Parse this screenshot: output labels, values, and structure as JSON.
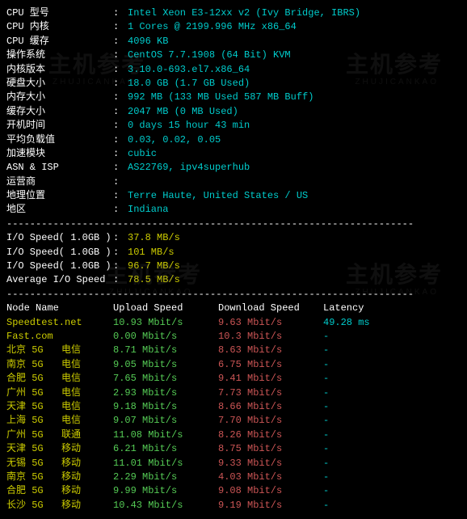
{
  "sys": {
    "rows": [
      {
        "label": "CPU 型号",
        "value": "Intel Xeon E3-12xx v2 (Ivy Bridge, IBRS)"
      },
      {
        "label": "CPU 内核",
        "value": "1 Cores @ 2199.996 MHz x86_64"
      },
      {
        "label": "CPU 缓存",
        "value": "4096 KB"
      },
      {
        "label": "操作系统",
        "value": "CentOS 7.7.1908 (64 Bit) KVM"
      },
      {
        "label": "内核版本",
        "value": "3.10.0-693.el7.x86_64"
      },
      {
        "label": "硬盘大小",
        "value": "18.0 GB (1.7 GB Used)"
      },
      {
        "label": "内存大小",
        "value": "992 MB (133 MB Used 587 MB Buff)"
      },
      {
        "label": "缓存大小",
        "value": "2047 MB (0 MB Used)"
      },
      {
        "label": "开机时间",
        "value": "0 days 15 hour 43 min"
      },
      {
        "label": "平均负载值",
        "value": "0.03, 0.02, 0.05"
      },
      {
        "label": "加速模块",
        "value": "cubic"
      },
      {
        "label": "ASN & ISP",
        "value": "AS22769, ipv4superhub"
      },
      {
        "label": "运营商",
        "value": ""
      },
      {
        "label": "地理位置",
        "value": "Terre Haute, United States / US"
      },
      {
        "label": "地区",
        "value": "Indiana"
      }
    ]
  },
  "io": {
    "rows": [
      {
        "label": "I/O Speed( 1.0GB )",
        "value": "37.8 MB/s"
      },
      {
        "label": "I/O Speed( 1.0GB )",
        "value": "101 MB/s"
      },
      {
        "label": "I/O Speed( 1.0GB )",
        "value": "96.7 MB/s"
      },
      {
        "label": "Average I/O Speed",
        "value": "78.5 MB/s"
      }
    ]
  },
  "speed": {
    "headers": {
      "node": "Node Name",
      "upload": "Upload Speed",
      "download": "Download Speed",
      "latency": "Latency"
    },
    "rows": [
      {
        "name": "Speedtest.net",
        "isp": "",
        "up": "10.93 Mbit/s",
        "down": "9.63 Mbit/s",
        "lat": "49.28 ms"
      },
      {
        "name": "Fast.com",
        "isp": "",
        "up": "0.00 Mbit/s",
        "down": "10.3 Mbit/s",
        "lat": "-"
      },
      {
        "name": "北京 5G",
        "isp": "电信",
        "up": "8.71 Mbit/s",
        "down": "8.63 Mbit/s",
        "lat": "-"
      },
      {
        "name": "南京 5G",
        "isp": "电信",
        "up": "9.05 Mbit/s",
        "down": "6.75 Mbit/s",
        "lat": "-"
      },
      {
        "name": "合肥 5G",
        "isp": "电信",
        "up": "7.65 Mbit/s",
        "down": "9.41 Mbit/s",
        "lat": "-"
      },
      {
        "name": "广州 5G",
        "isp": "电信",
        "up": "2.93 Mbit/s",
        "down": "7.73 Mbit/s",
        "lat": "-"
      },
      {
        "name": "天津 5G",
        "isp": "电信",
        "up": "9.18 Mbit/s",
        "down": "8.66 Mbit/s",
        "lat": "-"
      },
      {
        "name": "上海 5G",
        "isp": "电信",
        "up": "9.07 Mbit/s",
        "down": "7.70 Mbit/s",
        "lat": "-"
      },
      {
        "name": "广州 5G",
        "isp": "联通",
        "up": "11.08 Mbit/s",
        "down": "8.26 Mbit/s",
        "lat": "-"
      },
      {
        "name": "天津 5G",
        "isp": "移动",
        "up": "6.21 Mbit/s",
        "down": "8.75 Mbit/s",
        "lat": "-"
      },
      {
        "name": "无锡 5G",
        "isp": "移动",
        "up": "11.01 Mbit/s",
        "down": "9.33 Mbit/s",
        "lat": "-"
      },
      {
        "name": "南京 5G",
        "isp": "移动",
        "up": "2.29 Mbit/s",
        "down": "4.03 Mbit/s",
        "lat": "-"
      },
      {
        "name": "合肥 5G",
        "isp": "移动",
        "up": "9.99 Mbit/s",
        "down": "9.08 Mbit/s",
        "lat": "-"
      },
      {
        "name": "长沙 5G",
        "isp": "移动",
        "up": "10.43 Mbit/s",
        "down": "9.19 Mbit/s",
        "lat": "-"
      }
    ]
  },
  "divider": "----------------------------------------------------------------------"
}
